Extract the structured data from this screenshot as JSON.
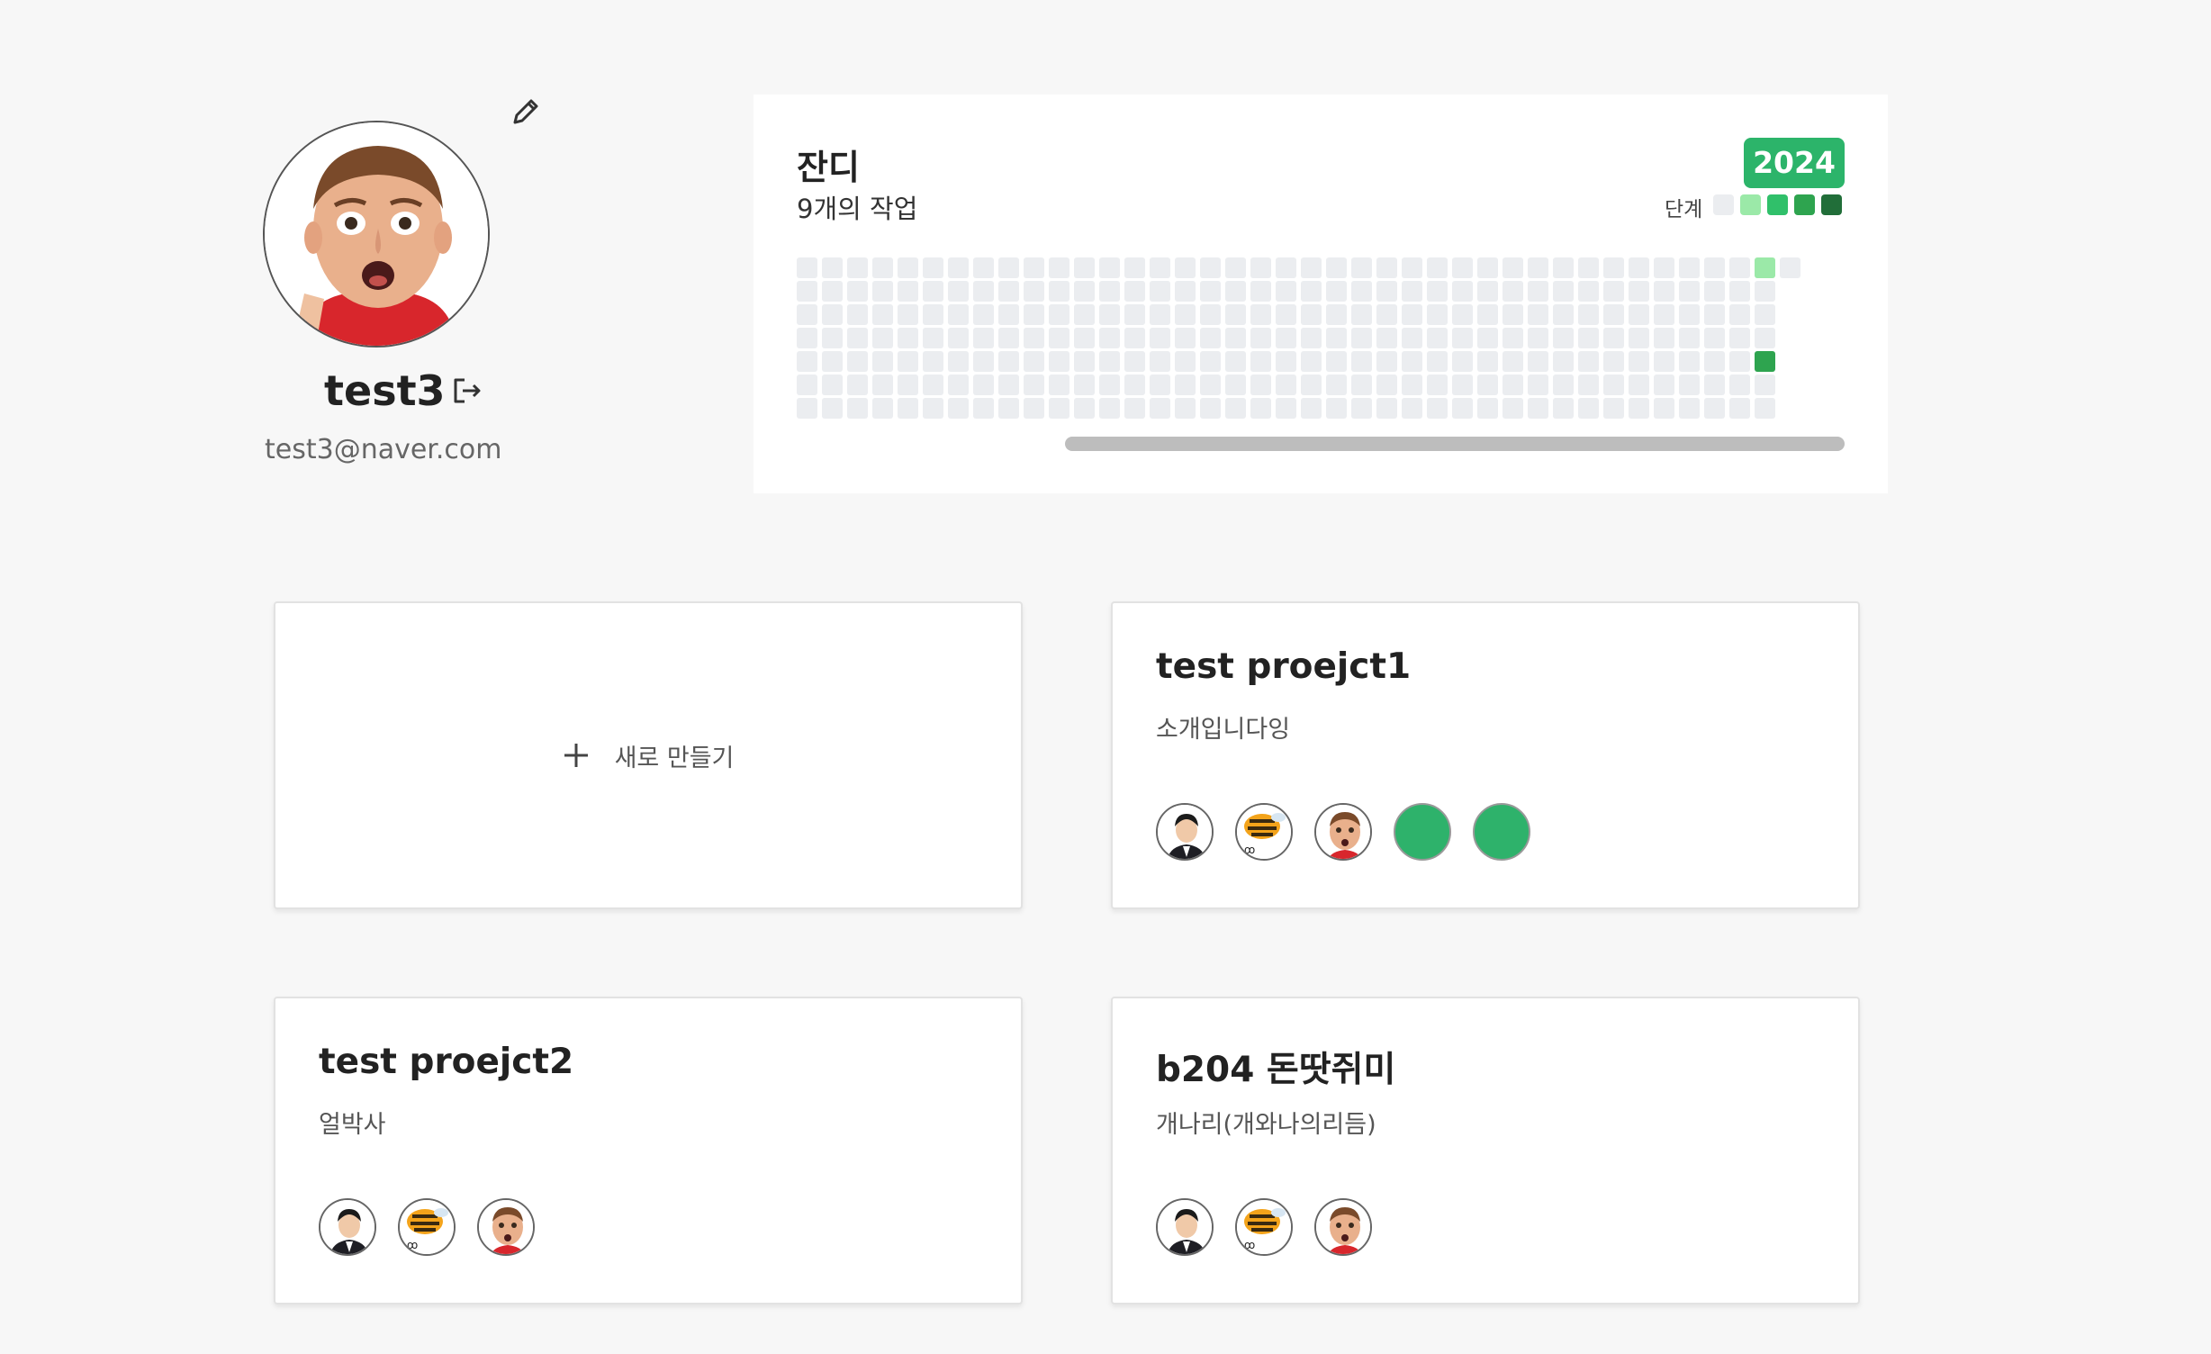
{
  "profile": {
    "username": "test3",
    "email": "test3@naver.com",
    "edit_icon": "pencil-icon",
    "logout_icon": "logout-icon"
  },
  "grass": {
    "title": "잔디",
    "count_text": "9개의 작업",
    "year": "2024",
    "level_label": "단계",
    "level_colors": [
      "#ebedf0",
      "#9be9a8",
      "#30c06a",
      "#2ea44f",
      "#216e39"
    ],
    "accent": "#2cb46a"
  },
  "projects": {
    "new_label": "새로 만들기",
    "items": [
      {
        "title": "test proejct1",
        "desc": "소개입니다잉"
      },
      {
        "title": "test proejct2",
        "desc": "얼박사"
      },
      {
        "title": "b204 돈땃쥐미",
        "desc": "개나리(개와나의리듬)"
      }
    ]
  },
  "member_icons": [
    "man-avatar-icon",
    "bee-avatar-icon",
    "boy-avatar-icon",
    "green-avatar-icon"
  ]
}
